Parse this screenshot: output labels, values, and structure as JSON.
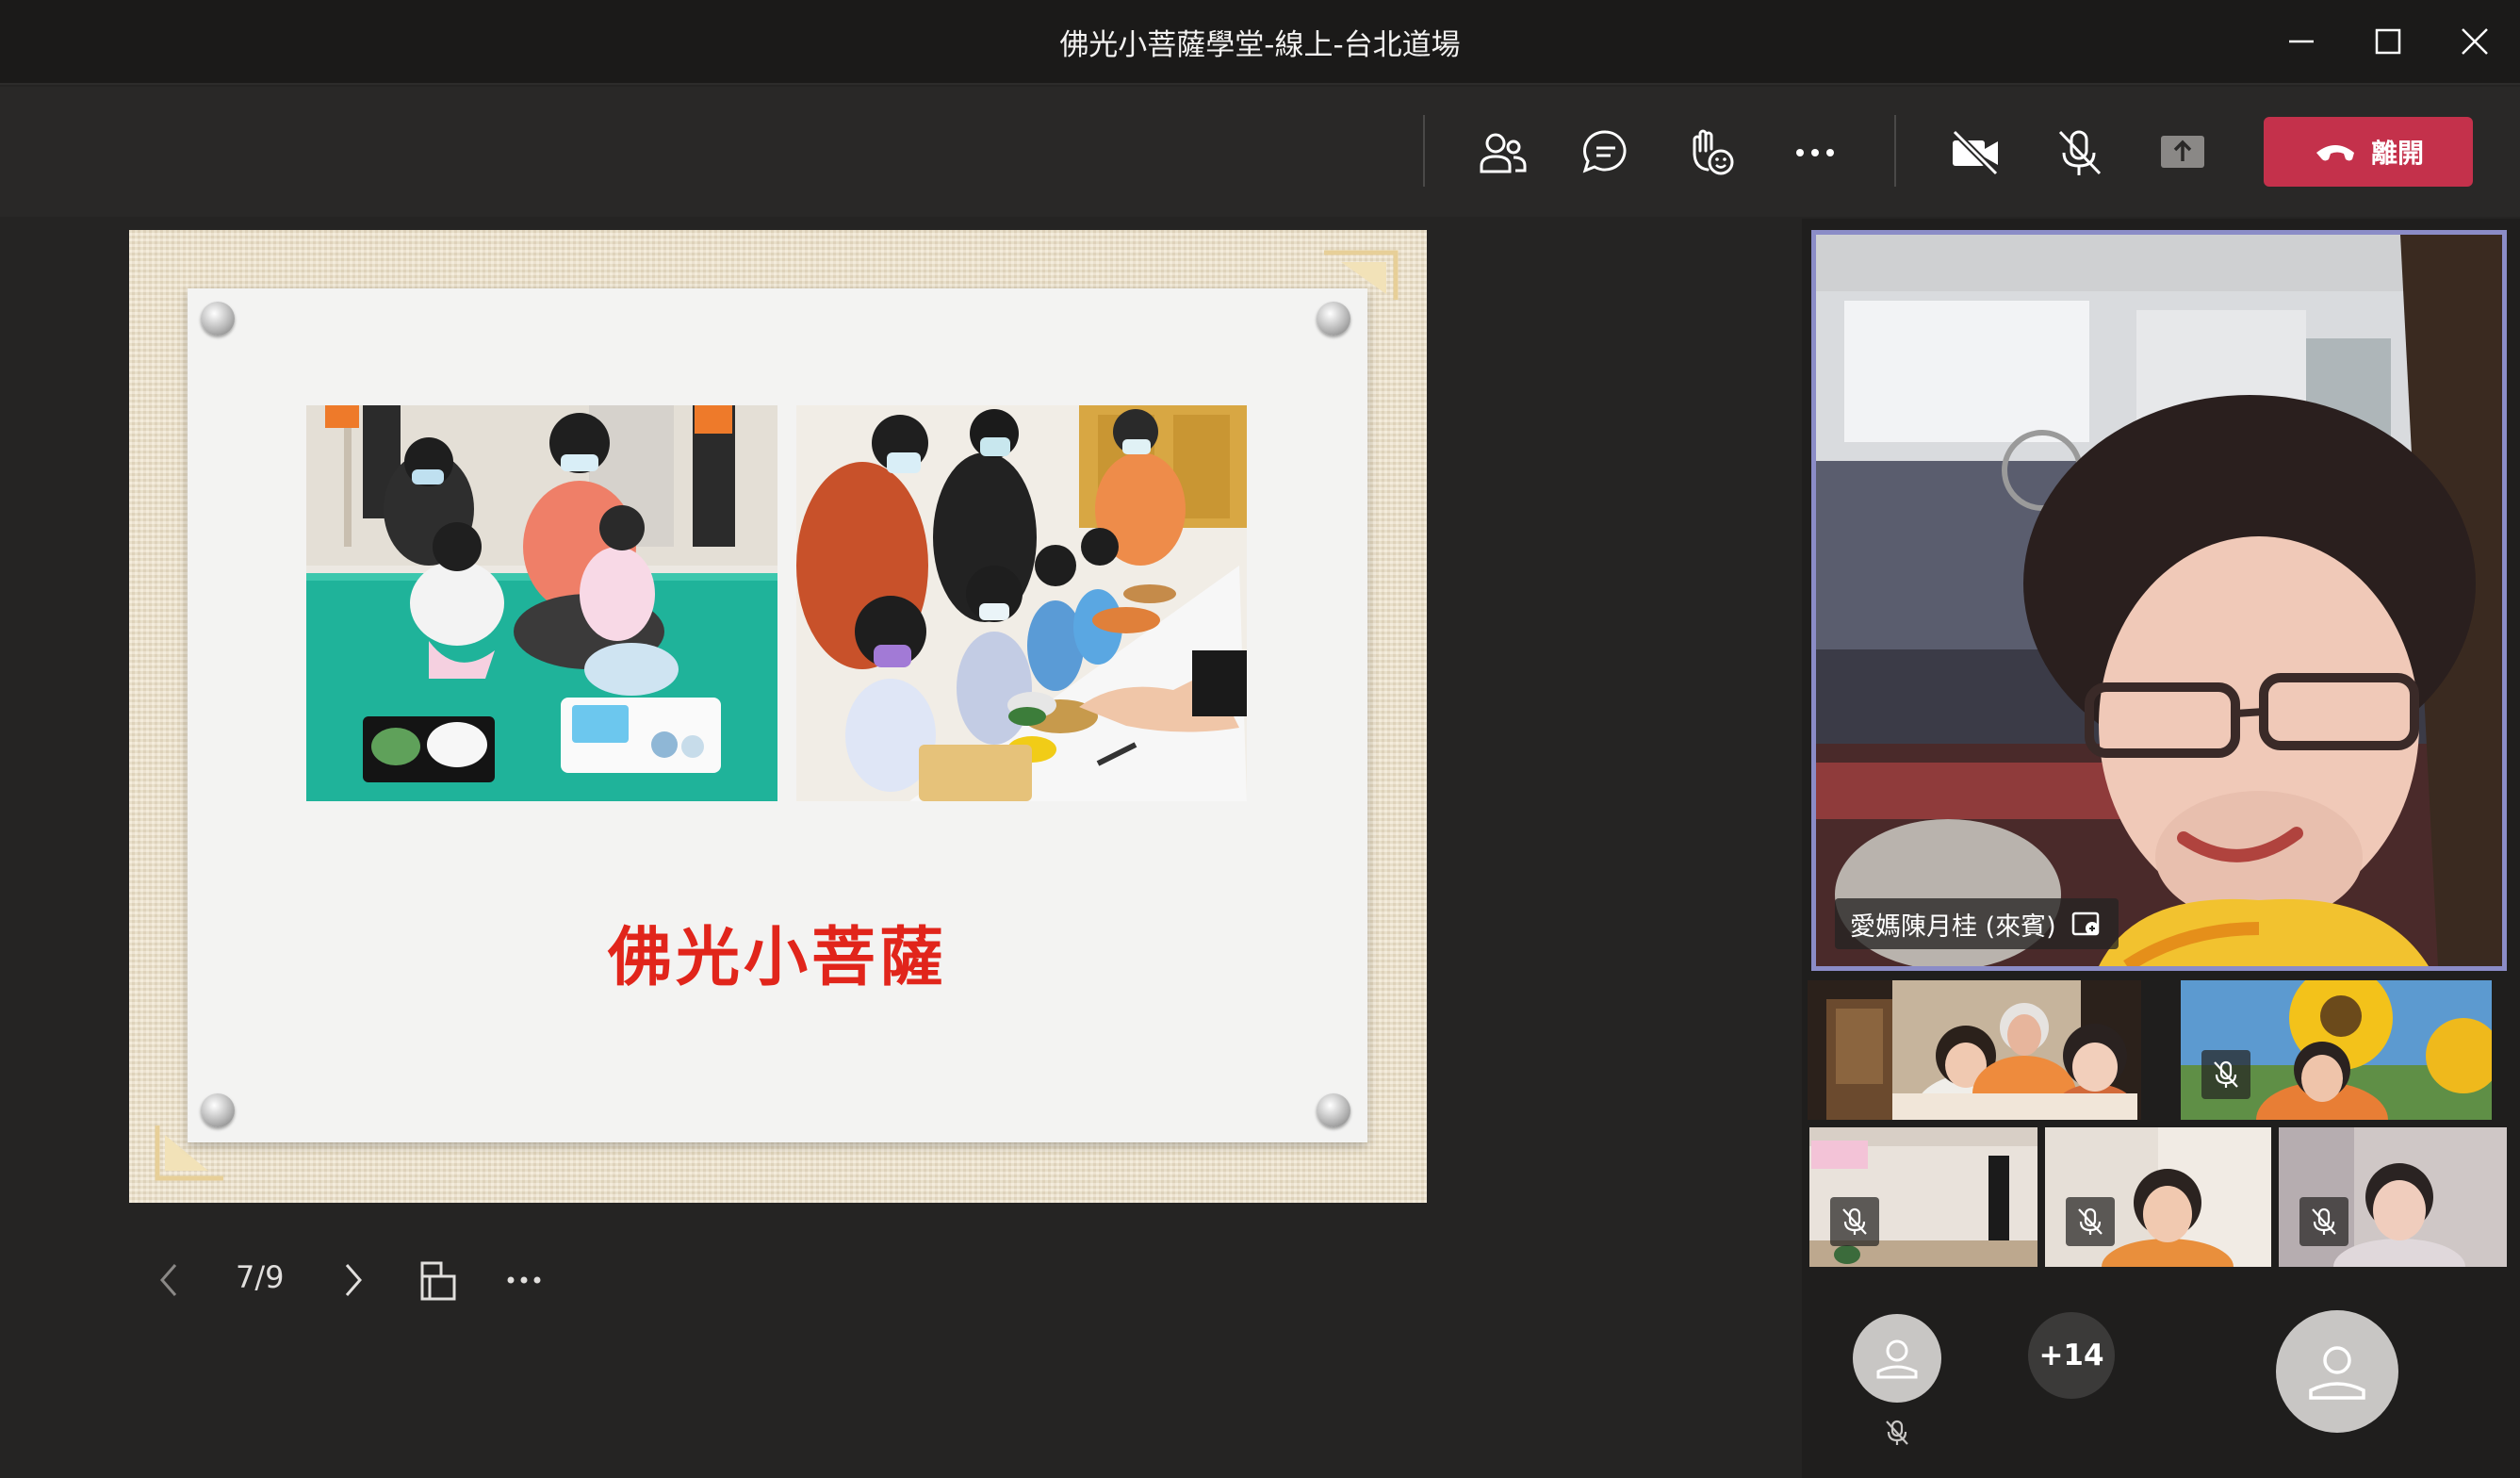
{
  "window": {
    "title": "佛光小菩薩學堂-線上-台北道場"
  },
  "toolbar": {
    "leave_label": "離開",
    "icons": [
      "participants-icon",
      "chat-icon",
      "reactions-icon",
      "more-icon",
      "camera-off-icon",
      "mic-off-icon",
      "share-tray-icon",
      "phone-icon"
    ]
  },
  "slide": {
    "caption": "佛光小菩薩",
    "page_counter": "7/9"
  },
  "main_participant": {
    "name": "愛媽陳月桂 (來賓)"
  },
  "gallery": {
    "overflow_count": "+14"
  },
  "colors": {
    "leave": "#c4314b",
    "active_border": "#8b8cc7",
    "slide_caption": "#e1251b"
  }
}
